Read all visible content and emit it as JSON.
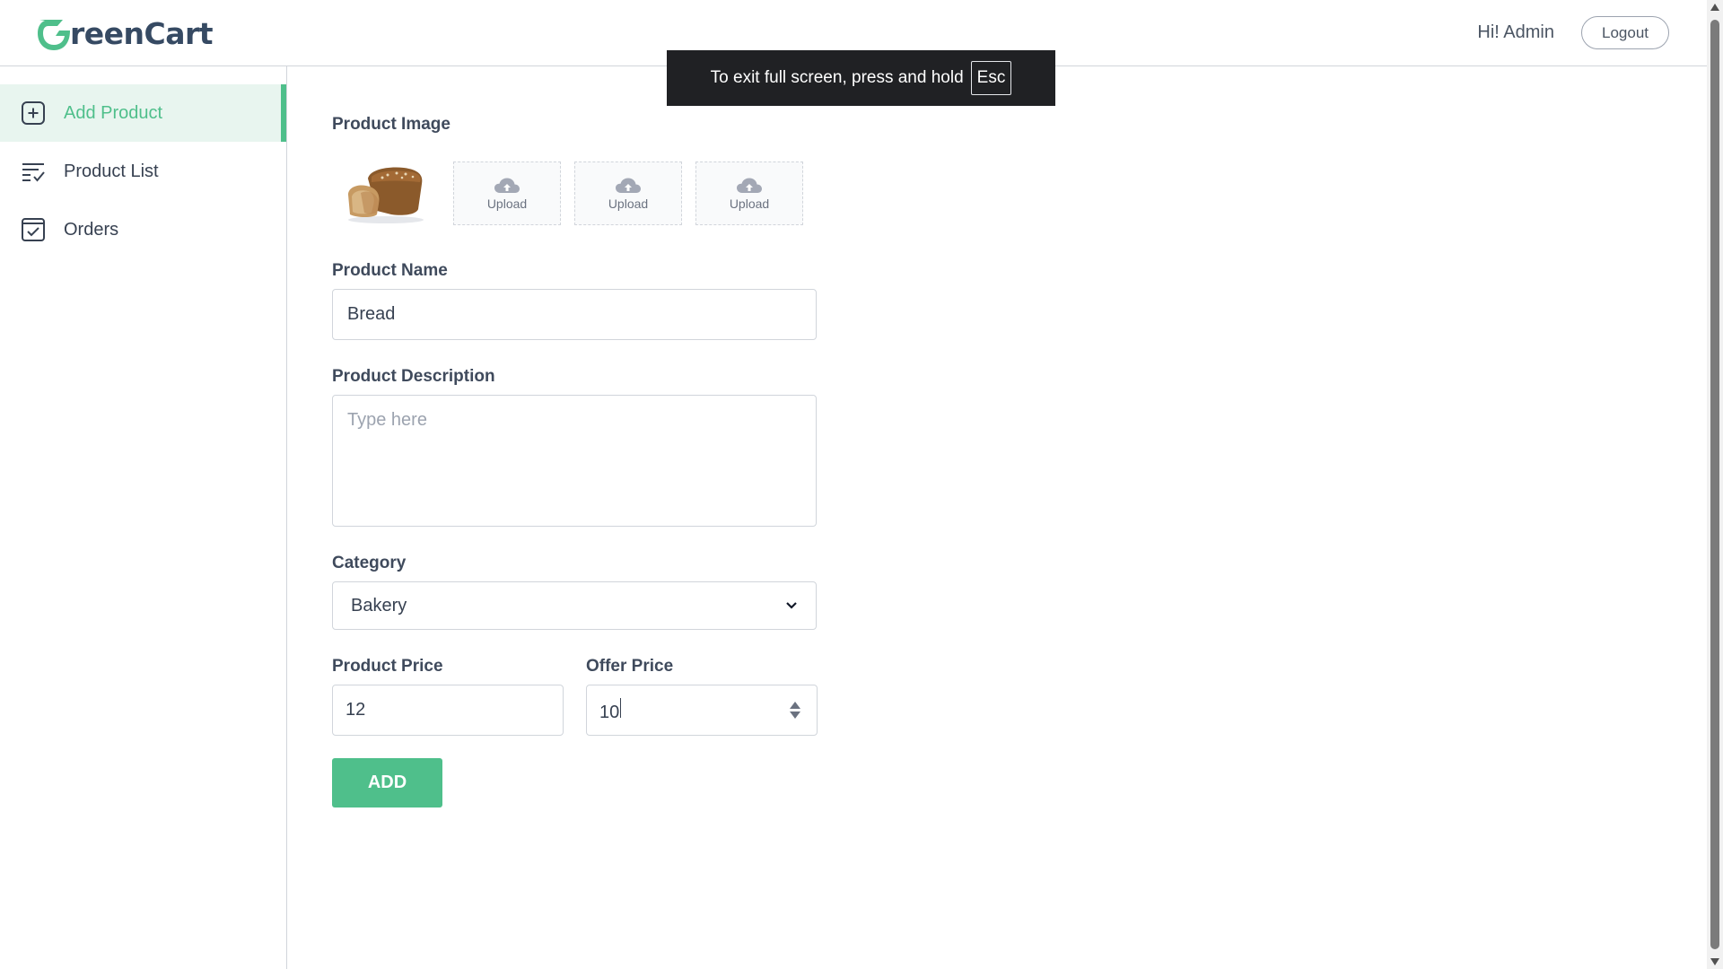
{
  "brand": {
    "logo_text": "reenCart",
    "logo_initial": "G",
    "accent": "#4fbf8b",
    "dark": "#364a63"
  },
  "header": {
    "greeting": "Hi! Admin",
    "logout_label": "Logout"
  },
  "sidebar": {
    "items": [
      {
        "label": "Add Product",
        "icon": "add-square-icon",
        "active": true
      },
      {
        "label": "Product List",
        "icon": "list-check-icon",
        "active": false
      },
      {
        "label": "Orders",
        "icon": "checkbox-icon",
        "active": false
      }
    ]
  },
  "form": {
    "image_label": "Product Image",
    "upload_slots": [
      {
        "state": "filled",
        "content": "bread-image"
      },
      {
        "state": "empty",
        "label": "Upload"
      },
      {
        "state": "empty",
        "label": "Upload"
      },
      {
        "state": "empty",
        "label": "Upload"
      }
    ],
    "name_label": "Product Name",
    "name_value": "Bread",
    "description_label": "Product Description",
    "description_placeholder": "Type here",
    "description_value": "",
    "category_label": "Category",
    "category_value": "Bakery",
    "price_label": "Product Price",
    "price_value": "12",
    "offer_price_label": "Offer Price",
    "offer_price_value": "10",
    "submit_label": "ADD"
  },
  "toast": {
    "text": "To exit full screen, press and hold",
    "key": "Esc"
  }
}
